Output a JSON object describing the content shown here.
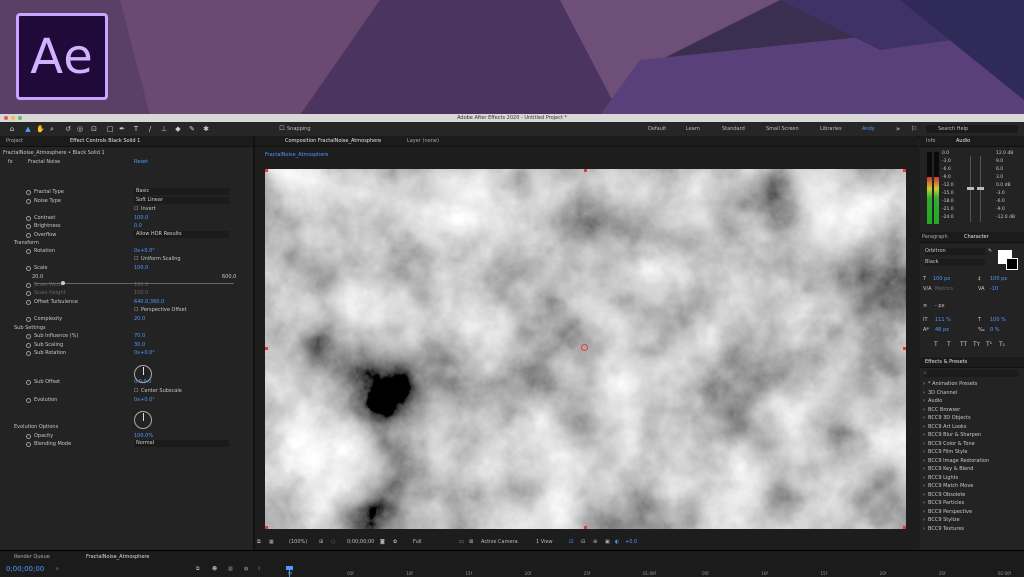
{
  "logo": {
    "text": "Ae"
  },
  "window": {
    "title": "Adobe After Effects 2020 - Untitled Project *"
  },
  "toolbar": {
    "snapping_label": "Snapping",
    "workspaces": [
      "Default",
      "Learn",
      "Standard",
      "Small Screen",
      "Libraries",
      "Andy"
    ],
    "active_workspace": "Andy",
    "search_placeholder": "Search Help"
  },
  "left_panel": {
    "tab_project": "Project",
    "tab_effect_controls": "Effect Controls Black Solid 1",
    "layer_title": "FractalNoise_Atmosphere • Black Solid 1",
    "fx": {
      "label": "fx",
      "name": "Fractal Noise",
      "reset": "Reset"
    },
    "rows": [
      {
        "label": "Fractal Type",
        "value": "Basic",
        "kind": "dropdown"
      },
      {
        "label": "Noise Type",
        "value": "Soft Linear",
        "kind": "dropdown"
      },
      {
        "label": "",
        "value": "Invert",
        "kind": "checkbox"
      },
      {
        "label": "Contrast",
        "value": "100.0",
        "kind": "number"
      },
      {
        "label": "Brightness",
        "value": "0.0",
        "kind": "number"
      },
      {
        "label": "Overflow",
        "value": "Allow HDR Results",
        "kind": "dropdown"
      },
      {
        "label": "Transform",
        "value": "",
        "kind": "group"
      },
      {
        "label": "Rotation",
        "value": "0x+0.0°",
        "kind": "number"
      },
      {
        "label": "",
        "value": "Uniform Scaling",
        "kind": "checkbox"
      },
      {
        "label": "Scale",
        "value": "100.0",
        "kind": "number"
      },
      {
        "label": "Scale Width",
        "value": "100.0",
        "kind": "disabled"
      },
      {
        "label": "Scale Height",
        "value": "100.0",
        "kind": "disabled"
      },
      {
        "label": "Offset Turbulence",
        "value": "640.0,360.0",
        "kind": "number"
      },
      {
        "label": "",
        "value": "Perspective Offset",
        "kind": "checkbox"
      },
      {
        "label": "Complexity",
        "value": "20.0",
        "kind": "number"
      },
      {
        "label": "Sub Settings",
        "value": "",
        "kind": "group"
      },
      {
        "label": "Sub Influence (%)",
        "value": "70.0",
        "kind": "number"
      },
      {
        "label": "Sub Scaling",
        "value": "30.0",
        "kind": "number"
      },
      {
        "label": "Sub Rotation",
        "value": "0x+0.0°",
        "kind": "number"
      },
      {
        "label": "Sub Offset",
        "value": "0.0,0.0",
        "kind": "number"
      },
      {
        "label": "",
        "value": "Center Subscale",
        "kind": "checkbox"
      },
      {
        "label": "Evolution",
        "value": "0x+0.0°",
        "kind": "number"
      },
      {
        "label": "Evolution Options",
        "value": "",
        "kind": "group"
      },
      {
        "label": "Opacity",
        "value": "100.0%",
        "kind": "number"
      },
      {
        "label": "Blending Mode",
        "value": "Normal",
        "kind": "dropdown"
      }
    ],
    "scale_min": "20.0",
    "scale_max": "600.0"
  },
  "composition": {
    "tab_label": "Composition FractalNoise_Atmosphere",
    "layer_tab": "Layer (none)",
    "breadcrumb": "FractalNoise_Atmosphere",
    "footer": {
      "zoom": "(100%)",
      "timecode": "0;00;00;00",
      "resolution": "Full",
      "camera": "Active Camera",
      "views": "1 View",
      "exposure": "+0.0"
    }
  },
  "right_panel": {
    "tab_info": "Info",
    "tab_audio": "Audio",
    "audio_left_scale": [
      "0.0",
      "-3.0",
      "-6.0",
      "-9.0",
      "-12.0",
      "-15.0",
      "-18.0",
      "-21.0",
      "-24.0"
    ],
    "audio_right_scale": [
      "12.0 dB",
      "9.0",
      "6.0",
      "3.0",
      "0.0 dB",
      "-3.0",
      "-6.0",
      "-9.0",
      "-12.0 dB"
    ],
    "tab_paragraph": "Paragraph",
    "tab_character": "Character",
    "font_family": "Orbitron",
    "font_style": "Black",
    "font_size": "100 px",
    "leading": "100 px",
    "kerning": "Metrics",
    "tracking": "-10",
    "stroke_width": "- px",
    "vert_scale": "111 %",
    "horiz_scale": "100 %",
    "baseline": "48 px",
    "tsume": "0 %",
    "type_buttons": [
      "T",
      "T",
      "TT",
      "Tт",
      "T¹",
      "T₁"
    ],
    "effects_tab": "Effects & Presets",
    "effects_search_placeholder": "",
    "effects_list": [
      "* Animation Presets",
      "3D Channel",
      "Audio",
      "BCC Browser",
      "BCC9 3D Objects",
      "BCC9 Art Looks",
      "BCC9 Blur & Sharpen",
      "BCC9 Color & Tone",
      "BCC9 Film Style",
      "BCC9 Image Restoration",
      "BCC9 Key & Blend",
      "BCC9 Lights",
      "BCC9 Match Move",
      "BCC9 Obsolete",
      "BCC9 Particles",
      "BCC9 Perspective",
      "BCC9 Stylize",
      "BCC9 Textures"
    ]
  },
  "timeline": {
    "tab_render_queue": "Render Queue",
    "tab_comp": "FractalNoise_Atmosphere",
    "timecode": "0;00;00;00",
    "ruler": [
      "0f",
      "05f",
      "10f",
      "15f",
      "20f",
      "25f",
      "01:00f",
      "05f",
      "10f",
      "15f",
      "20f",
      "25f",
      "02:00f"
    ]
  },
  "colors": {
    "accent": "#4d9bff",
    "handle": "#e23b3b",
    "logo_bg": "#1f0a3a",
    "logo_fg": "#d3b1ff"
  }
}
